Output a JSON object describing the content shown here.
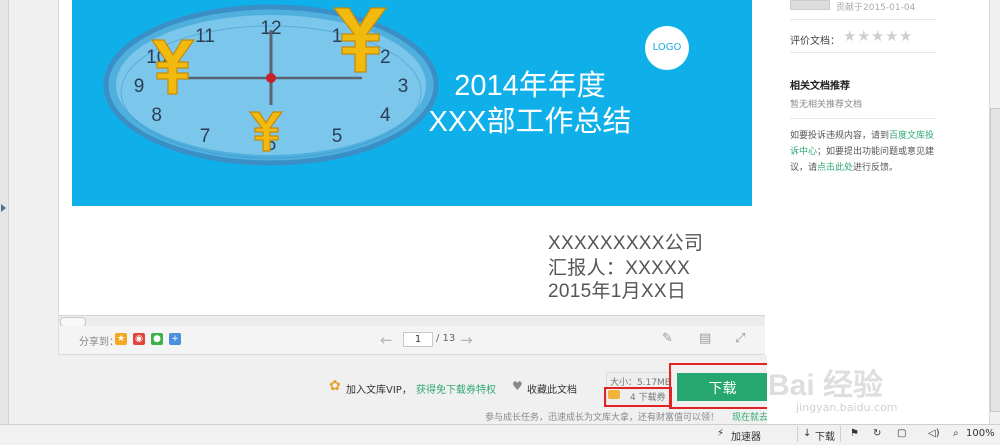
{
  "slide": {
    "title_line1": "2014年年度",
    "title_line2": "XXX部工作总结",
    "logo": "LOGO",
    "clock_numbers": [
      "12",
      "1",
      "2",
      "3",
      "4",
      "5",
      "6",
      "7",
      "8",
      "9",
      "10",
      "11"
    ]
  },
  "doc_info": {
    "company": "XXXXXXXXX公司",
    "reporter": "汇报人：XXXXX",
    "date": "2015年1月XX日"
  },
  "toolbar": {
    "share_label": "分享到：",
    "share_icons": [
      "qzone-icon",
      "weibo-icon",
      "wechat-icon",
      "more-share-icon"
    ],
    "current_page": "1",
    "total_pages": "/ 13"
  },
  "download_bar": {
    "vip_text": "加入文库VIP，",
    "vip_link": "获得免下载券特权",
    "favorite_text": "收藏此文档",
    "size_text": "大小：5.17MB",
    "coupon_text": "4 下载券",
    "download_label": "下载",
    "task_text": "参与成长任务，迅速成长为文库大拿，还有财富值可以领！",
    "task_link": "现在就去 > >"
  },
  "sidebar": {
    "upload_date": "贡献于2015-01-04",
    "rate_label": "评价文档：",
    "recommend_title": "相关文档推荐",
    "recommend_empty": "暂无相关推荐文档",
    "report_line1_a": "如要投诉违规内容，请到",
    "report_line1_link": "百度文库投",
    "report_line2_link": "诉中心",
    "report_line2_b": "；如要提出功能问题或意见建",
    "report_line3_a": "议，请",
    "report_line3_link": "点击此处",
    "report_line3_b": "进行反馈。"
  },
  "watermark": {
    "main": "Bai 经验",
    "sub": "jingyan.baidu.com"
  },
  "statusbar": {
    "accelerator": "加速器",
    "download": "下载",
    "zoom": "100%"
  },
  "colors": {
    "slide_bg": "#0fb0ea",
    "accent_green": "#27a770",
    "highlight_red": "#e02424"
  }
}
